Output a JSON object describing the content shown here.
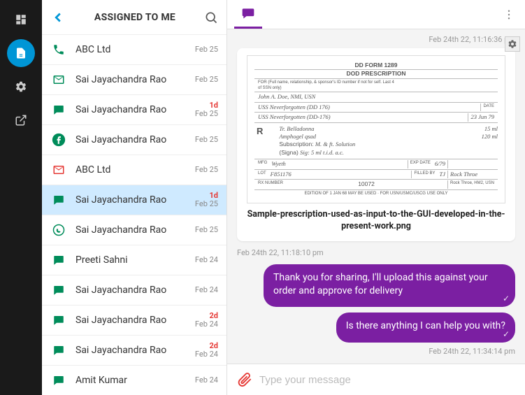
{
  "rail": [
    {
      "name": "dashboard-icon"
    },
    {
      "name": "inbox-icon",
      "active": true
    },
    {
      "name": "settings-icon"
    },
    {
      "name": "external-icon"
    }
  ],
  "header": {
    "title": "ASSIGNED TO ME"
  },
  "conversations": [
    {
      "channel": "phone",
      "color": "#008c5a",
      "name": "ABC Ltd",
      "badge": "",
      "date": "Feb 25"
    },
    {
      "channel": "email",
      "color": "#008c5a",
      "name": "Sai Jayachandra Rao",
      "badge": "",
      "date": "Feb 25"
    },
    {
      "channel": "sms",
      "color": "#008c5a",
      "name": "Sai Jayachandra Rao",
      "badge": "1d",
      "date": "Feb 25"
    },
    {
      "channel": "facebook",
      "color": "#008c5a",
      "name": "Sai Jayachandra Rao",
      "badge": "",
      "date": "Feb 25"
    },
    {
      "channel": "email",
      "color": "#e53935",
      "name": "ABC Ltd",
      "badge": "",
      "date": "Feb 25"
    },
    {
      "channel": "sms",
      "color": "#008c5a",
      "name": "Sai Jayachandra Rao",
      "badge": "1d",
      "date": "Feb 25",
      "selected": true
    },
    {
      "channel": "whatsapp",
      "color": "#008c5a",
      "name": "Sai Jayachandra Rao",
      "badge": "",
      "date": "Feb 25"
    },
    {
      "channel": "sms",
      "color": "#008c5a",
      "name": "Preeti Sahni",
      "badge": "",
      "date": "Feb 24"
    },
    {
      "channel": "sms",
      "color": "#008c5a",
      "name": "Sai Jayachandra Rao",
      "badge": "",
      "date": "Feb 24"
    },
    {
      "channel": "sms",
      "color": "#008c5a",
      "name": "Sai Jayachandra Rao",
      "badge": "2d",
      "date": "Feb 24"
    },
    {
      "channel": "sms",
      "color": "#008c5a",
      "name": "Sai Jayachandra Rao",
      "badge": "2d",
      "date": "Feb 24"
    },
    {
      "channel": "sms",
      "color": "#008c5a",
      "name": "Amit Kumar",
      "badge": "",
      "date": "Feb 24"
    }
  ],
  "chat": {
    "timestamps": {
      "t1": "Feb 24th 22, 11:16:36 pm",
      "t2": "Feb 24th 22, 11:18:10 pm",
      "t3": "Feb 24th 22, 11:34:14 pm"
    },
    "attachment": {
      "caption": "Sample-prescription-used-as-input-to-the-GUI-developed-in-the-present-work.png",
      "doc": {
        "form_hdr": "DD  FORM  1289",
        "title": "DOD PRESCRIPTION",
        "row1_label": "FOR (Full name, relationship, & sponsor's ID number if not for self. Last 4 of SSN only)",
        "row1_val": "John A. Doe, NMI, USN",
        "row2_a": "USS Neverforgotten   (DD 176)",
        "row2_b": "DATE",
        "row2_date": "23 Jun 79",
        "row3": "USS Neverforgotten (DD-176)",
        "rx": "R",
        "l1": "Tr. Belladonna",
        "v1": "15 ml",
        "l2": "Amphogel qsad",
        "v2": "120 ml",
        "sub": "Subscription:",
        "sub_v": "M. & ft. Solution",
        "sig": "(Signa)",
        "sig_v": "Sig: 5 ml t.i.d. a.c.",
        "mfg": "MFG",
        "mfg_v": "Wyeth",
        "exp": "EXP DATE",
        "exp_v": "6/79",
        "lot": "LOT",
        "lot_v": "F851176",
        "filled": "FILLED BY",
        "filled_v": "TJ",
        "signame": "Rock Throe",
        "sigline": "Rock Throe, HM2, USN",
        "num_lbl": "RX NUMBER",
        "num_v": "10072",
        "foot": "EDITION OF 1 JAN 68 MAY BE USED · FOR USN/USMC/USCG USE ONLY"
      }
    },
    "messages": [
      {
        "text": "Thank you for sharing, I'll upload this against your order and approve for delivery"
      },
      {
        "text": "Is there anything I can help you with?"
      }
    ]
  },
  "composer": {
    "placeholder": "Type your message"
  }
}
